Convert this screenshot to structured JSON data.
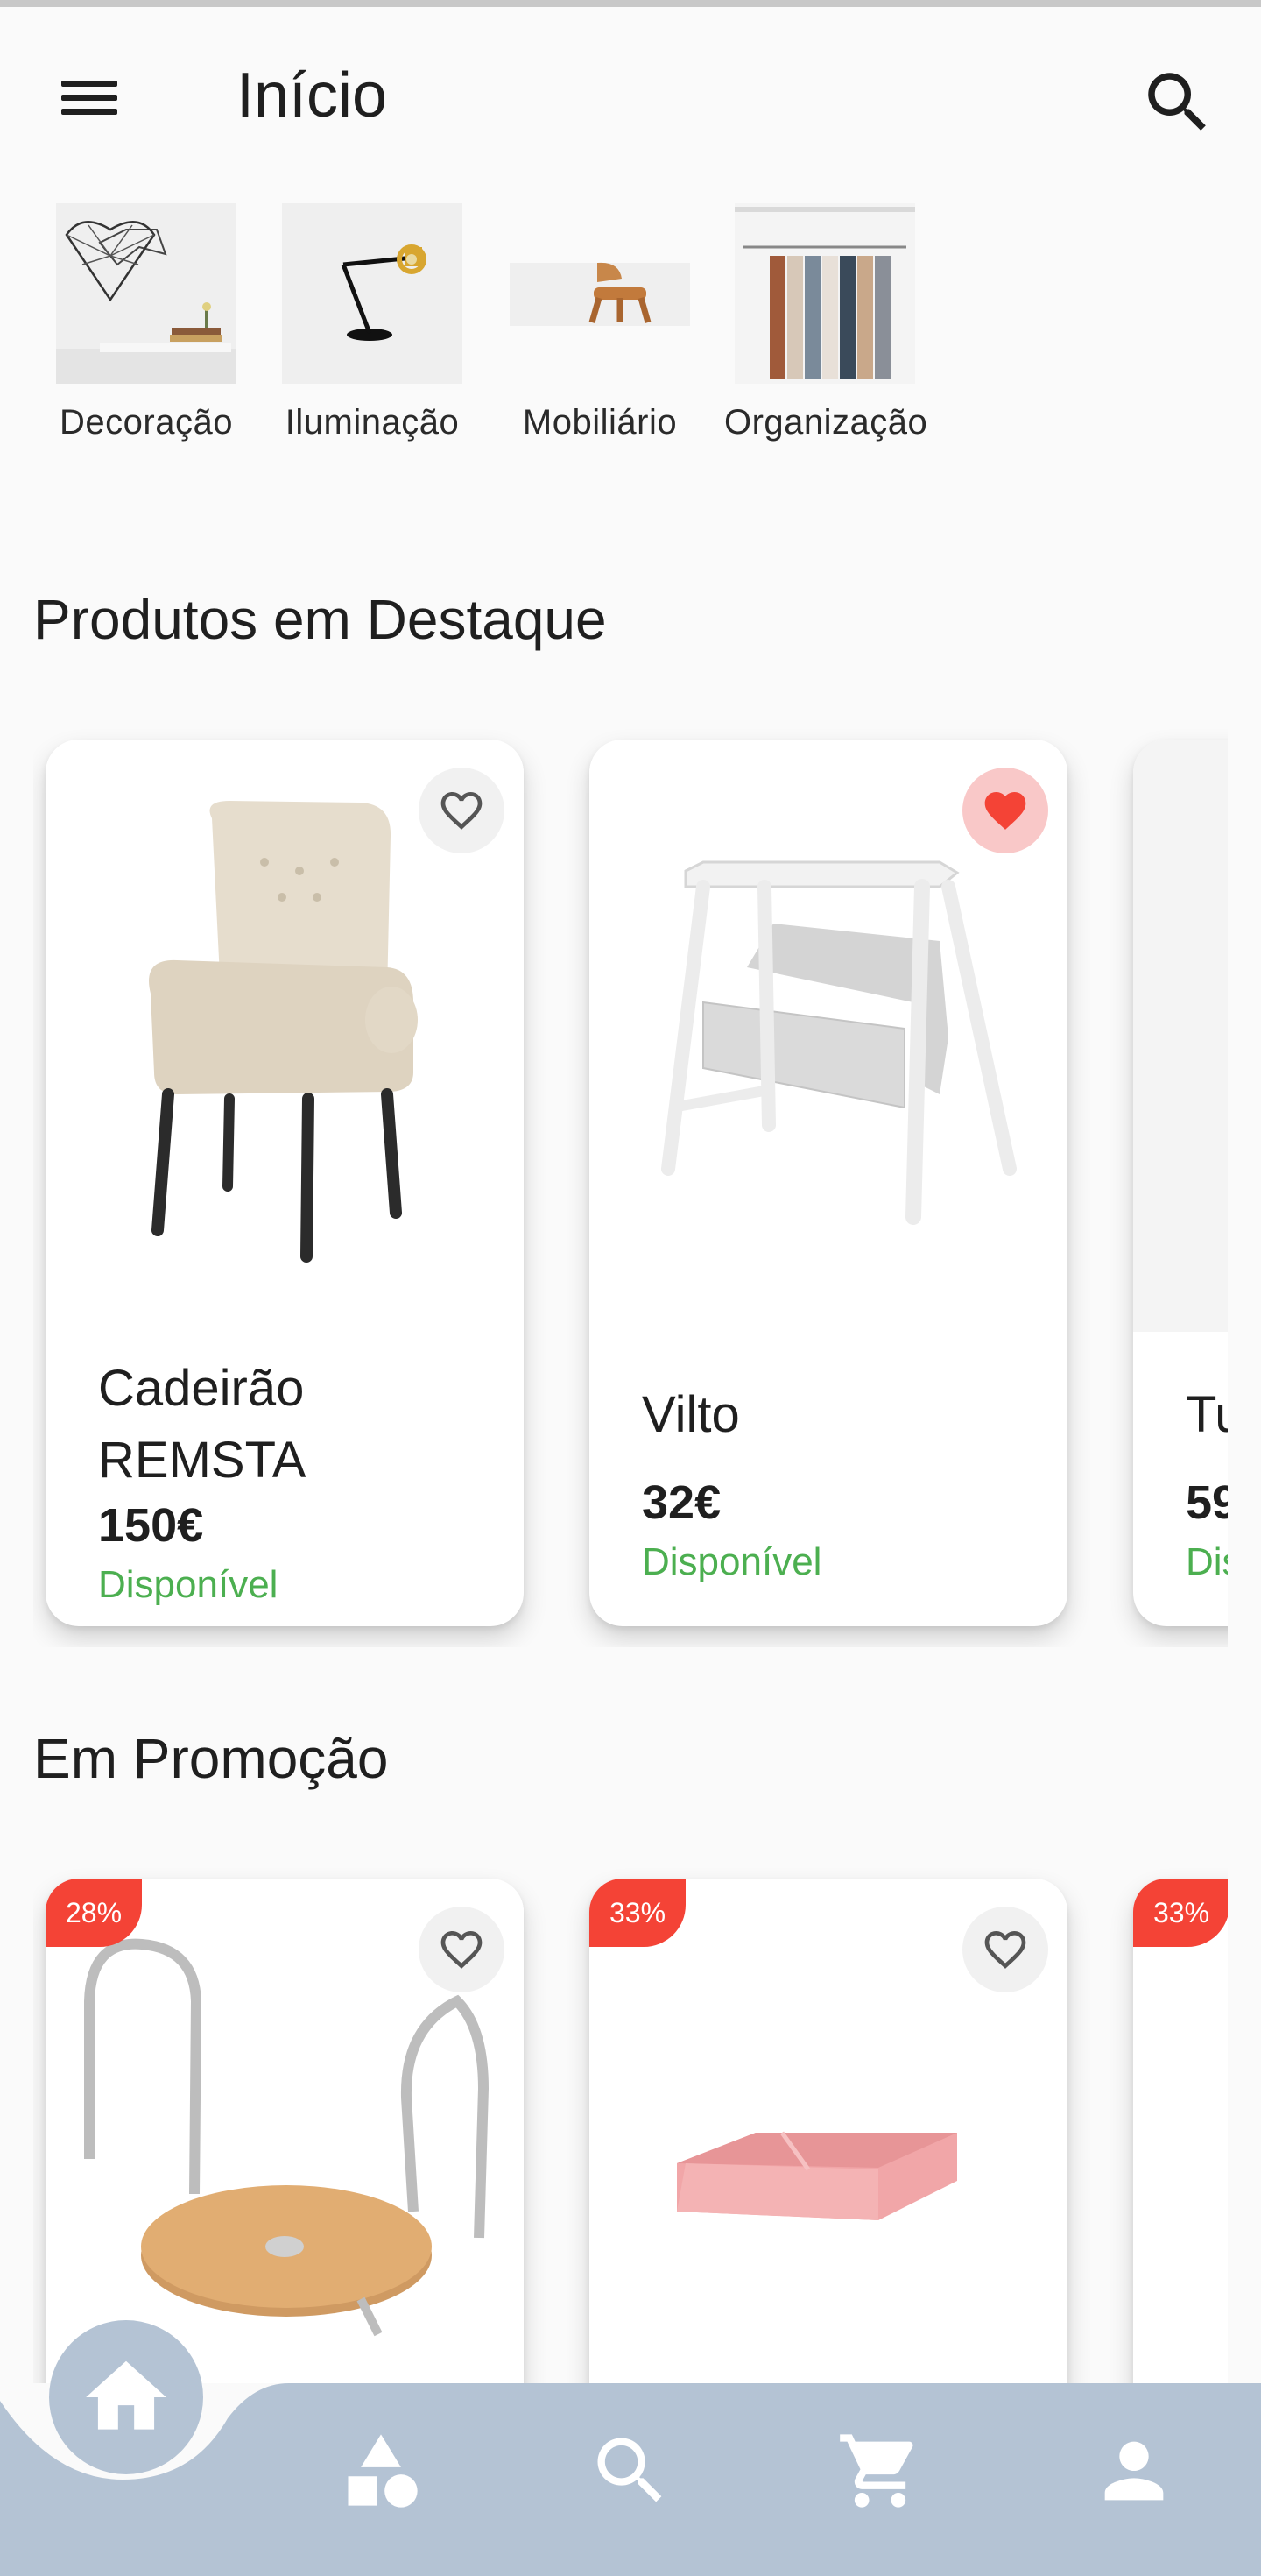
{
  "app_bar": {
    "title": "Início",
    "menu_icon": "menu-icon",
    "search_icon": "search-icon"
  },
  "categories": [
    {
      "label": "Decoração",
      "icon": "heart-wireframe-image"
    },
    {
      "label": "Iluminação",
      "icon": "desk-lamp-image"
    },
    {
      "label": "Mobiliário",
      "icon": "wooden-chair-image"
    },
    {
      "label": "Organização",
      "icon": "clothes-rack-image"
    }
  ],
  "featured": {
    "title": "Produtos em Destaque",
    "products": [
      {
        "name": "Cadeirão REMSTA",
        "price": "150€",
        "status": "Disponível",
        "favorite": false,
        "image": "armchair-image"
      },
      {
        "name": "Vilto",
        "price": "32€",
        "status": "Disponível",
        "favorite": true,
        "image": "step-stool-image"
      },
      {
        "name": "Tu",
        "price": "59",
        "status": "Dis",
        "favorite": false,
        "image": "partial-product-image"
      }
    ]
  },
  "promotions": {
    "title": "Em Promoção",
    "products": [
      {
        "discount": "28%",
        "favorite": false,
        "image": "bar-stool-image"
      },
      {
        "discount": "33%",
        "favorite": false,
        "image": "pink-box-image"
      },
      {
        "discount": "33%",
        "favorite": false,
        "image": "partial-product-image"
      }
    ]
  },
  "bottom_nav": {
    "items": [
      "home-icon",
      "categories-icon",
      "search-icon",
      "cart-icon",
      "account-icon"
    ],
    "active": "home-icon",
    "color": "#b4c3d4"
  },
  "colors": {
    "available": "#4caf50",
    "discount_badge": "#f44336",
    "favorite_active": "#f44336"
  }
}
